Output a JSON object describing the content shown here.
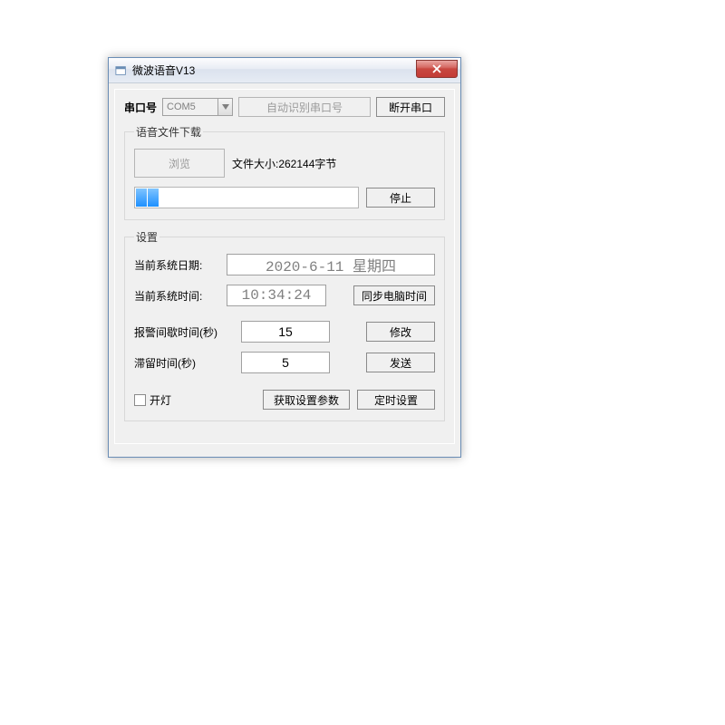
{
  "window": {
    "title": "微波语音V13"
  },
  "serial": {
    "label": "串口号",
    "port": "COM5",
    "auto_detect": "自动识别串口号",
    "disconnect": "断开串口"
  },
  "download": {
    "legend": "语音文件下载",
    "browse": "浏览",
    "filesize_label": "文件大小:262144字节",
    "stop": "停止"
  },
  "settings": {
    "legend": "设置",
    "sysdate_label": "当前系统日期:",
    "sysdate_value": "2020-6-11 星期四",
    "systime_label": "当前系统时间:",
    "systime_value": "10:34:24",
    "sync_pc_time": "同步电脑时间",
    "alarm_interval_label": "报警间歇时间(秒)",
    "alarm_interval_value": "15",
    "modify": "修改",
    "dwell_label": "滞留时间(秒)",
    "dwell_value": "5",
    "send": "发送",
    "light_on": "开灯",
    "get_params": "获取设置参数",
    "timer_settings": "定时设置"
  }
}
